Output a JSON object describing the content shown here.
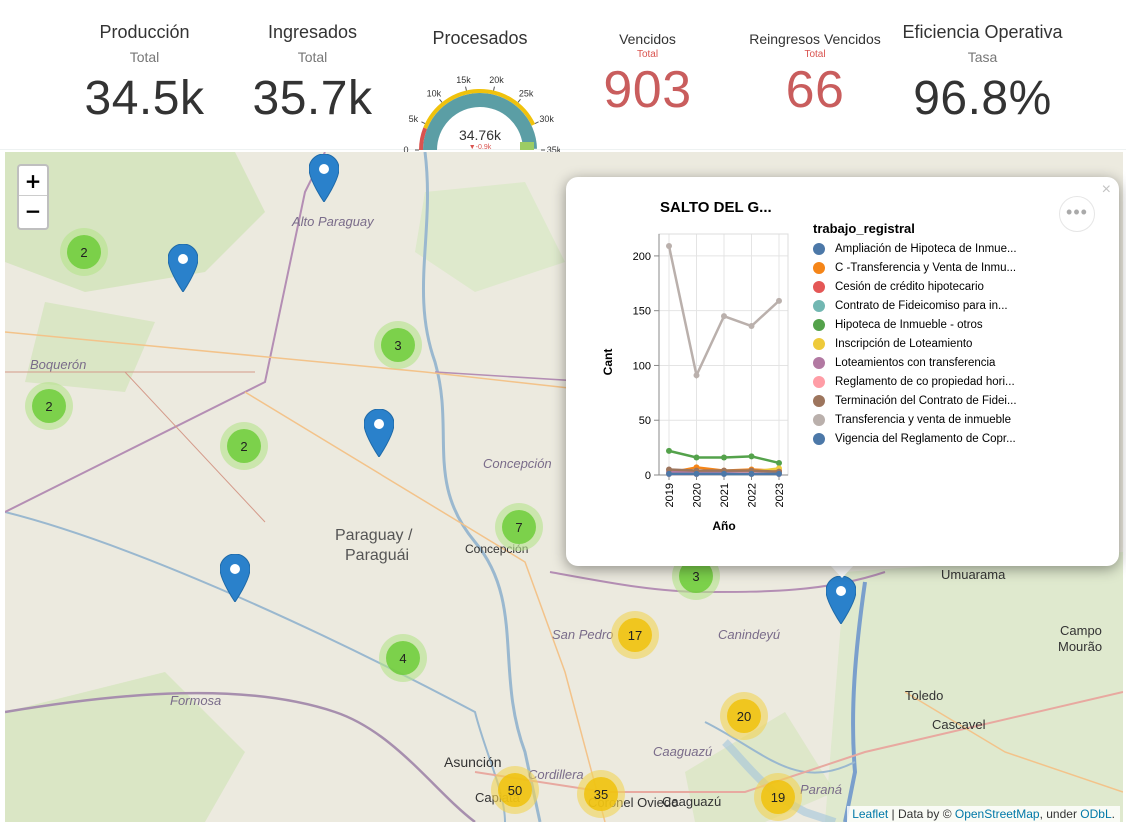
{
  "kpis": {
    "produccion": {
      "label": "Producción",
      "sub": "Total",
      "value": "34.5k"
    },
    "ingresados": {
      "label": "Ingresados",
      "sub": "Total",
      "value": "35.7k"
    },
    "procesados": {
      "label": "Procesados",
      "value": "34.76k",
      "delta": "▼-0.9k",
      "ticks": [
        "0",
        "5k",
        "10k",
        "15k",
        "20k",
        "25k",
        "30k",
        "35k"
      ],
      "fraction": 0.993
    },
    "vencidos": {
      "label": "Vencidos",
      "sub": "Total",
      "value": "903"
    },
    "reingresos": {
      "label": "Reingresos Vencidos",
      "sub": "Total",
      "value": "66"
    },
    "eficiencia": {
      "label": "Eficiencia Operativa",
      "sub": "Tasa",
      "value": "96.8%"
    }
  },
  "map": {
    "zoom_in": "+",
    "zoom_out": "−",
    "places": [
      "Alto Paraguay",
      "Boquerón",
      "Concepción",
      "Paraguay /",
      "Paraguái",
      "Concepción",
      "San Pedro",
      "Canindeyú",
      "Umuarama",
      "Campo",
      "Mourão",
      "Formosa",
      "Toledo",
      "Cascavel",
      "Caaguazú",
      "Asunción",
      "Cordillera",
      "Caaguazú",
      "Paraná",
      "Capiatá",
      "Coronel Oviedo"
    ],
    "clusters": [
      "2",
      "3",
      "2",
      "2",
      "7",
      "3",
      "4",
      "17",
      "20",
      "50",
      "35",
      "19"
    ],
    "attribution": {
      "leaflet": "Leaflet",
      "data_by": " | Data by © ",
      "osm": "OpenStreetMap",
      "under": ", under ",
      "odbl": "ODbL",
      "end": "."
    }
  },
  "popup": {
    "close": "×",
    "menu": "•••",
    "chart_data": {
      "type": "line",
      "title": "SALTO DEL G...",
      "xlabel": "Año",
      "ylabel": "Cant",
      "x": [
        "2019",
        "2020",
        "2021",
        "2022",
        "2023"
      ],
      "ylim": [
        0,
        220
      ],
      "yticks": [
        0,
        50,
        100,
        150,
        200
      ],
      "legend_title": "trabajo_registral",
      "series": [
        {
          "name": "Ampliación de Hipoteca de Inmue...",
          "color": "#4c78a8",
          "values": [
            1,
            1,
            1,
            1,
            1
          ]
        },
        {
          "name": "C -Transferencia y Venta de Inmu...",
          "color": "#f58518",
          "values": [
            2,
            7,
            4,
            5,
            4
          ]
        },
        {
          "name": "Cesión de crédito hipotecario",
          "color": "#e45756",
          "values": [
            1,
            1,
            2,
            1,
            1
          ]
        },
        {
          "name": "Contrato de Fideicomiso para in...",
          "color": "#72b7b2",
          "values": [
            1,
            1,
            1,
            1,
            1
          ]
        },
        {
          "name": "Hipoteca de Inmueble - otros",
          "color": "#54a24b",
          "values": [
            22,
            16,
            16,
            17,
            11
          ]
        },
        {
          "name": "Inscripción de Loteamiento",
          "color": "#eeca3b",
          "values": [
            2,
            3,
            3,
            3,
            6
          ]
        },
        {
          "name": "Loteamientos con transferencia",
          "color": "#b279a2",
          "values": [
            3,
            2,
            3,
            3,
            3
          ]
        },
        {
          "name": "Reglamento de co propiedad hori...",
          "color": "#ff9da6",
          "values": [
            1,
            1,
            1,
            2,
            1
          ]
        },
        {
          "name": "Terminación del Contrato de Fidei...",
          "color": "#9d755d",
          "values": [
            5,
            4,
            4,
            4,
            3
          ]
        },
        {
          "name": "Transferencia y venta de inmueble",
          "color": "#bab0ac",
          "values": [
            209,
            91,
            145,
            136,
            159
          ]
        },
        {
          "name": "Vigencia del Reglamento de Copr...",
          "color": "#4c78a8",
          "values": [
            1,
            1,
            1,
            1,
            1
          ]
        }
      ]
    }
  }
}
